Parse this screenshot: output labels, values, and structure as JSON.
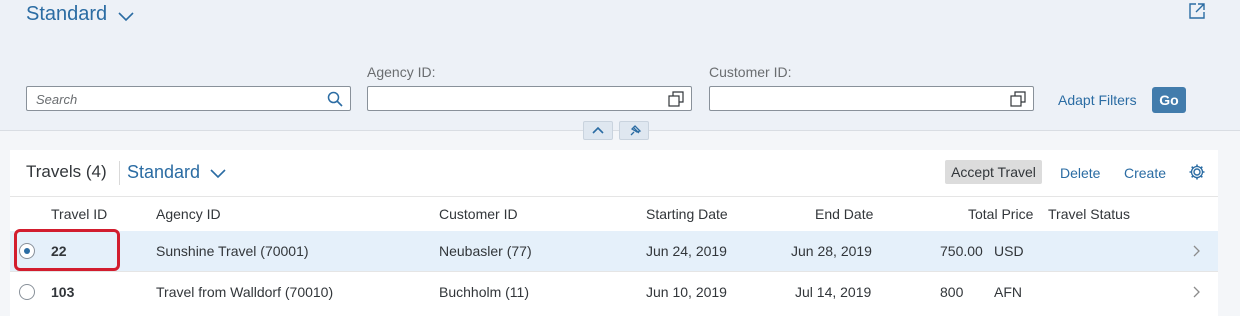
{
  "header": {
    "variant_name": "Standard",
    "search_placeholder": "Search",
    "agency_label": "Agency ID:",
    "customer_label": "Customer ID:",
    "adapt_filters_label": "Adapt Filters",
    "go_label": "Go"
  },
  "table": {
    "title": "Travels (4)",
    "variant_name": "Standard",
    "toolbar": {
      "accept_label": "Accept Travel",
      "delete_label": "Delete",
      "create_label": "Create"
    },
    "columns": [
      "Travel ID",
      "Agency ID",
      "Customer ID",
      "Starting Date",
      "End Date",
      "Total Price",
      "Travel Status"
    ],
    "rows": [
      {
        "travel_id": "22",
        "agency": "Sunshine Travel (70001)",
        "customer": "Neubasler (77)",
        "start": "Jun 24, 2019",
        "end": "Jun 28, 2019",
        "price": "750.00",
        "currency": "USD",
        "status": "",
        "selected": true
      },
      {
        "travel_id": "103",
        "agency": "Travel from Walldorf (70010)",
        "customer": "Buchholm (11)",
        "start": "Jun 10, 2019",
        "end": "Jul 14, 2019",
        "price": "800",
        "currency": "AFN",
        "status": "",
        "selected": false
      }
    ]
  },
  "colors": {
    "accent": "#2b6ca3",
    "go_button": "#427cac",
    "highlight": "#d21d2e",
    "selected_row": "#e5f0fa"
  }
}
